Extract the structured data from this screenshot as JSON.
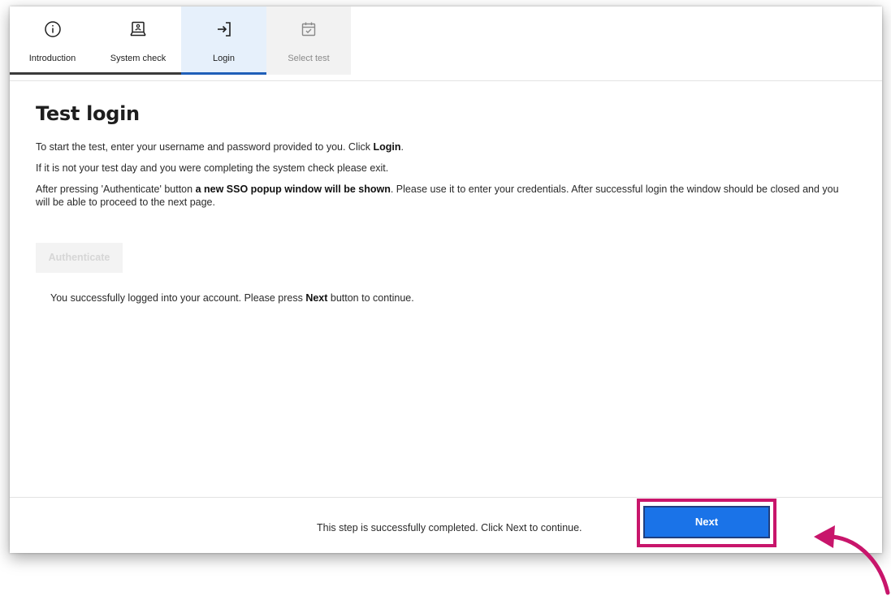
{
  "tabs": [
    {
      "label": "Introduction",
      "icon": "info-icon",
      "state": "completed"
    },
    {
      "label": "System check",
      "icon": "computer-check-icon",
      "state": "completed"
    },
    {
      "label": "Login",
      "icon": "login-arrow-icon",
      "state": "active"
    },
    {
      "label": "Select test",
      "icon": "calendar-check-icon",
      "state": "disabled"
    }
  ],
  "page": {
    "title": "Test login",
    "para1_prefix": "To start the test, enter your username and password provided to you. Click ",
    "para1_bold": "Login",
    "para1_suffix": ".",
    "para2": "If it is not your test day and you were completing the system check please exit.",
    "para3_prefix": "After pressing 'Authenticate' button ",
    "para3_bold": "a new SSO popup window will be shown",
    "para3_suffix": ". Please use it to enter your credentials. After successful login the window should be closed and you will be able to proceed to the next page.",
    "authenticate_label": "Authenticate",
    "success_prefix": "You successfully logged into your account. Please press ",
    "success_bold": "Next",
    "success_suffix": " button to continue."
  },
  "footer": {
    "message": "This step is successfully completed. Click Next to continue.",
    "next_label": "Next"
  },
  "colors": {
    "accent": "#1a73e8",
    "active_tab_bg": "#e6f0fb",
    "active_tab_underline": "#1f5fb8",
    "highlight": "#c8156b"
  }
}
